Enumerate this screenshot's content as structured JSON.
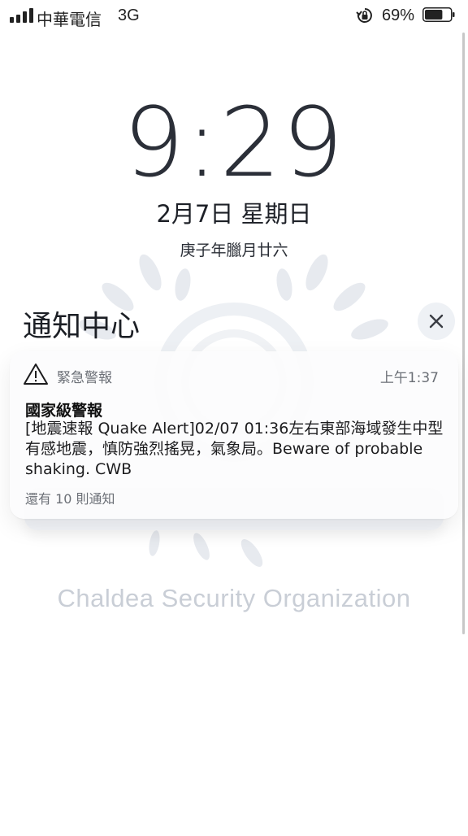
{
  "status_bar": {
    "carrier": "中華電信",
    "network": "3G",
    "battery_percent": "69%",
    "battery_level": 0.69,
    "icons": [
      "signal-icon",
      "rotation-lock-icon",
      "battery-icon"
    ]
  },
  "lockscreen": {
    "time": "9:29",
    "date": "2月7日 星期日",
    "lunar_date": "庚子年臘月廿六"
  },
  "notification_center": {
    "title": "通知中心",
    "close_icon": "close-icon"
  },
  "notification": {
    "app_icon": "warning-triangle-icon",
    "app_name": "緊急警報",
    "time": "上午1:37",
    "title": "國家級警報",
    "body": "[地震速報 Quake Alert]02/07 01:36左右東部海域發生中型有感地震，慎防強烈搖晃，氣象局。Beware of probable shaking. CWB",
    "more": "還有 10 則通知"
  },
  "wallpaper": {
    "caption": "Chaldea Security Organization"
  },
  "colors": {
    "clock": "#2b2f38",
    "wallpaper_mark": "#c9ced6",
    "secondary_text": "#6b6f76"
  }
}
